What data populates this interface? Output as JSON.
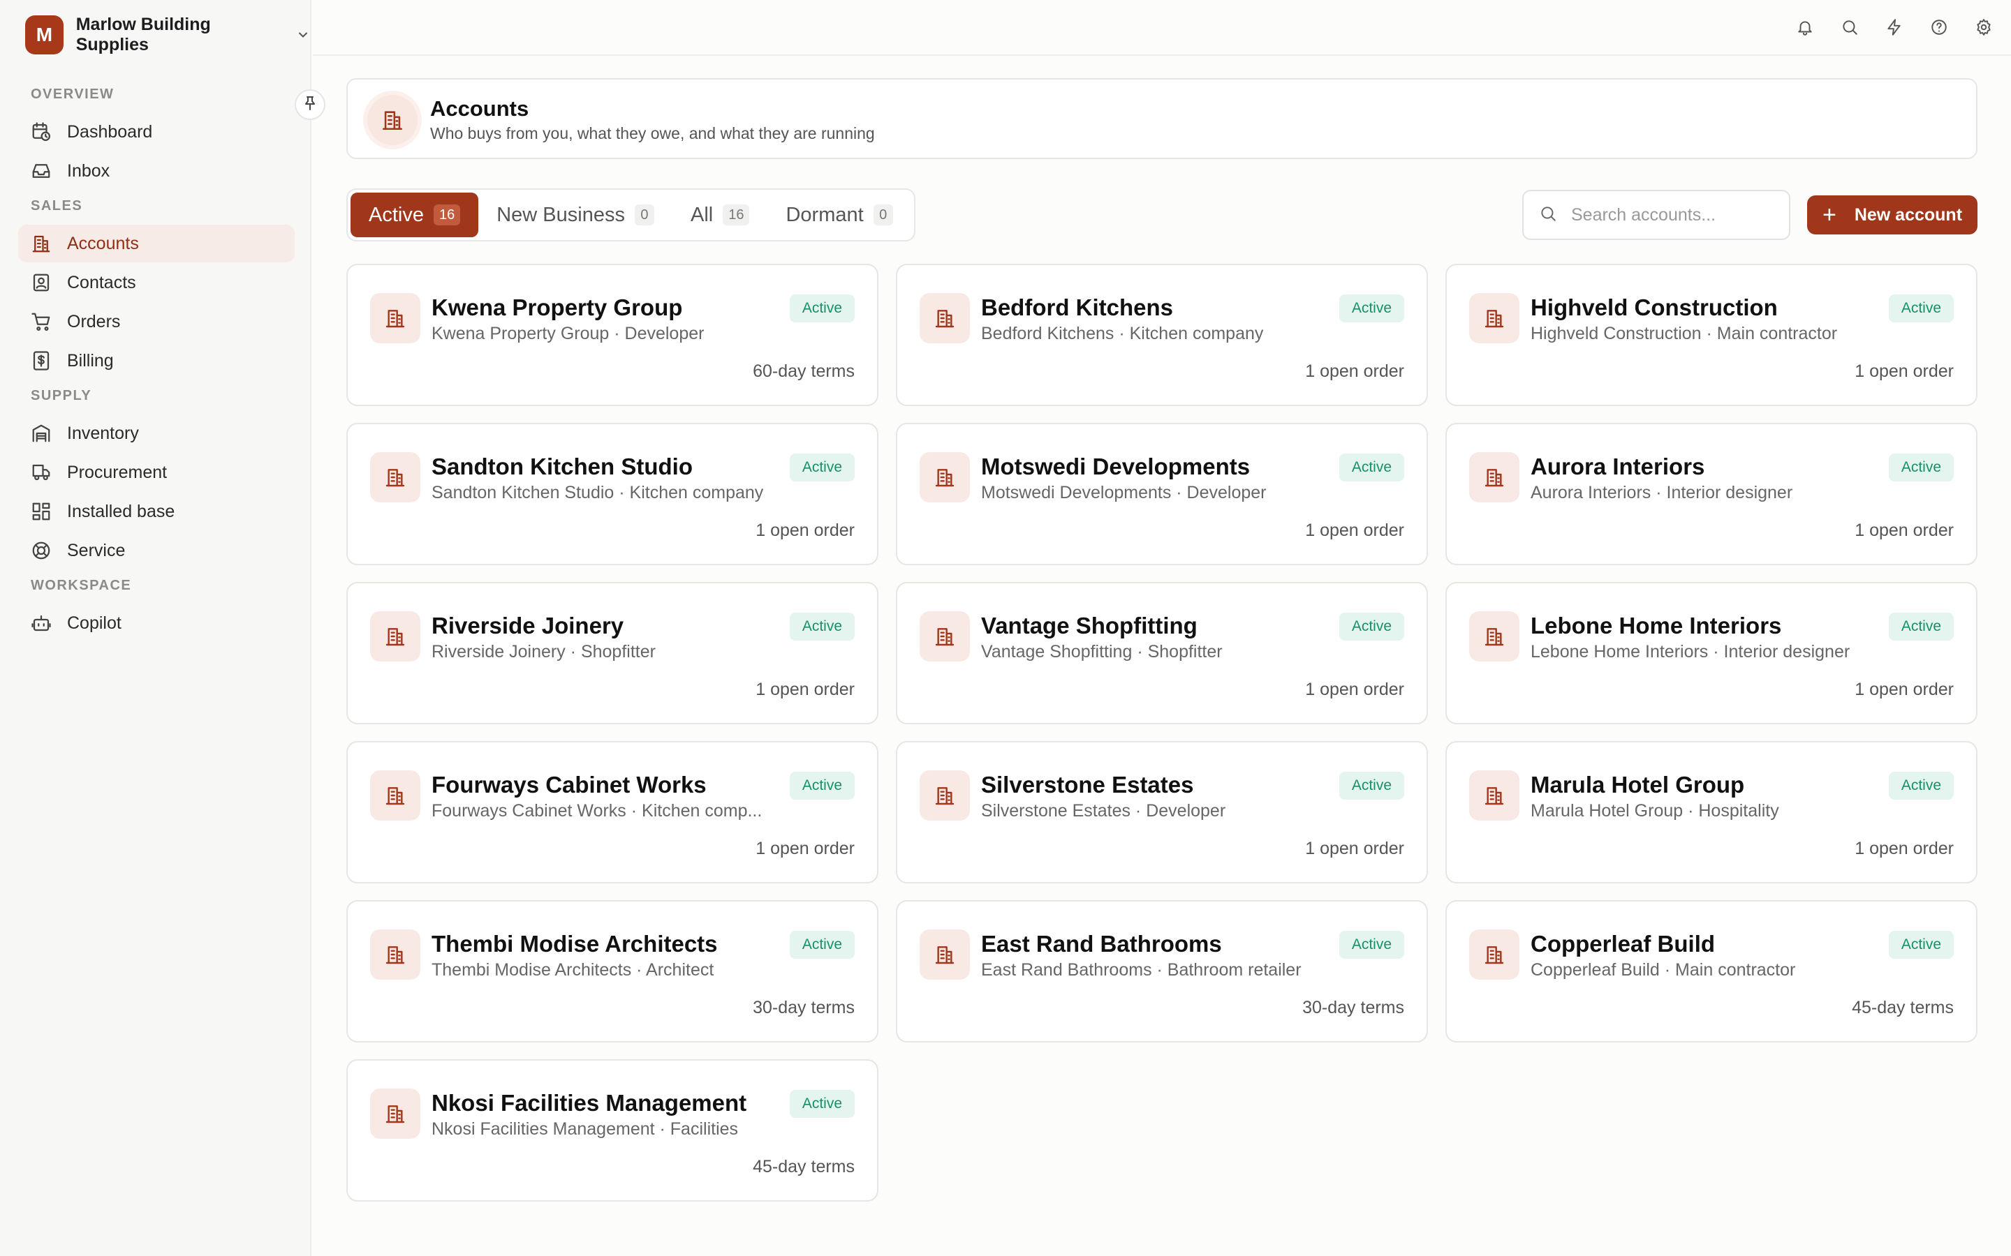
{
  "brand": {
    "initial": "M",
    "name": "Marlow Building Supplies"
  },
  "sidebar": {
    "sections": [
      {
        "label": "OVERVIEW",
        "items": [
          {
            "label": "Dashboard",
            "icon": "calendar-clock-icon"
          },
          {
            "label": "Inbox",
            "icon": "inbox-icon"
          }
        ]
      },
      {
        "label": "SALES",
        "items": [
          {
            "label": "Accounts",
            "icon": "building-icon",
            "active": true
          },
          {
            "label": "Contacts",
            "icon": "contact-icon"
          },
          {
            "label": "Orders",
            "icon": "cart-icon"
          },
          {
            "label": "Billing",
            "icon": "dollar-file-icon"
          }
        ]
      },
      {
        "label": "SUPPLY",
        "items": [
          {
            "label": "Inventory",
            "icon": "warehouse-icon"
          },
          {
            "label": "Procurement",
            "icon": "truck-icon"
          },
          {
            "label": "Installed base",
            "icon": "grid-icon"
          },
          {
            "label": "Service",
            "icon": "lifebuoy-icon"
          }
        ]
      },
      {
        "label": "WORKSPACE",
        "items": [
          {
            "label": "Copilot",
            "icon": "bot-icon"
          }
        ]
      }
    ]
  },
  "topbar": {
    "icons": [
      "bell-icon",
      "search-icon",
      "bolt-icon",
      "help-icon",
      "gear-icon"
    ]
  },
  "header": {
    "title": "Accounts",
    "subtitle": "Who buys from you, what they owe, and what they are running"
  },
  "tabs": [
    {
      "label": "Active",
      "count": "16",
      "active": true
    },
    {
      "label": "New Business",
      "count": "0"
    },
    {
      "label": "All",
      "count": "16"
    },
    {
      "label": "Dormant",
      "count": "0"
    }
  ],
  "search": {
    "placeholder": "Search accounts..."
  },
  "new_button": {
    "label": "New account"
  },
  "colors": {
    "accent": "#a0361a",
    "active_badge_bg": "#e3f5ee",
    "active_badge_text": "#17906a"
  },
  "accounts": [
    {
      "name": "Kwena Property Group",
      "subtitle": "Kwena Property Group · Developer",
      "status": "Active",
      "meta": "60-day terms"
    },
    {
      "name": "Bedford Kitchens",
      "subtitle": "Bedford Kitchens · Kitchen company",
      "status": "Active",
      "meta": "1 open order"
    },
    {
      "name": "Highveld Construction",
      "subtitle": "Highveld Construction · Main contractor",
      "status": "Active",
      "meta": "1 open order"
    },
    {
      "name": "Sandton Kitchen Studio",
      "subtitle": "Sandton Kitchen Studio · Kitchen company",
      "status": "Active",
      "meta": "1 open order"
    },
    {
      "name": "Motswedi Developments",
      "subtitle": "Motswedi Developments · Developer",
      "status": "Active",
      "meta": "1 open order"
    },
    {
      "name": "Aurora Interiors",
      "subtitle": "Aurora Interiors · Interior designer",
      "status": "Active",
      "meta": "1 open order"
    },
    {
      "name": "Riverside Joinery",
      "subtitle": "Riverside Joinery · Shopfitter",
      "status": "Active",
      "meta": "1 open order"
    },
    {
      "name": "Vantage Shopfitting",
      "subtitle": "Vantage Shopfitting · Shopfitter",
      "status": "Active",
      "meta": "1 open order"
    },
    {
      "name": "Lebone Home Interiors",
      "subtitle": "Lebone Home Interiors · Interior designer",
      "status": "Active",
      "meta": "1 open order"
    },
    {
      "name": "Fourways Cabinet Works",
      "subtitle": "Fourways Cabinet Works · Kitchen comp...",
      "status": "Active",
      "meta": "1 open order"
    },
    {
      "name": "Silverstone Estates",
      "subtitle": "Silverstone Estates · Developer",
      "status": "Active",
      "meta": "1 open order"
    },
    {
      "name": "Marula Hotel Group",
      "subtitle": "Marula Hotel Group · Hospitality",
      "status": "Active",
      "meta": "1 open order"
    },
    {
      "name": "Thembi Modise Architects",
      "subtitle": "Thembi Modise Architects · Architect",
      "status": "Active",
      "meta": "30-day terms"
    },
    {
      "name": "East Rand Bathrooms",
      "subtitle": "East Rand Bathrooms · Bathroom retailer",
      "status": "Active",
      "meta": "30-day terms"
    },
    {
      "name": "Copperleaf Build",
      "subtitle": "Copperleaf Build · Main contractor",
      "status": "Active",
      "meta": "45-day terms"
    },
    {
      "name": "Nkosi Facilities Management",
      "subtitle": "Nkosi Facilities Management · Facilities",
      "status": "Active",
      "meta": "45-day terms"
    }
  ]
}
